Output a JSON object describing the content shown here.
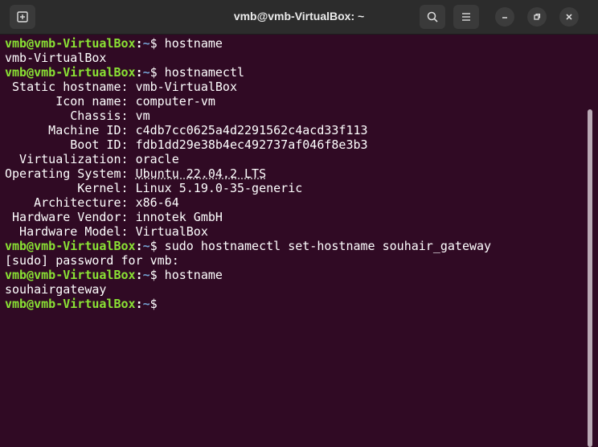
{
  "window": {
    "title": "vmb@vmb-VirtualBox: ~"
  },
  "prompt": {
    "user_host": "vmb@vmb-VirtualBox",
    "colon": ":",
    "path": "~",
    "symbol": "$"
  },
  "terminal": {
    "lines": [
      {
        "type": "prompt",
        "cmd": " hostname"
      },
      {
        "type": "output",
        "text": "vmb-VirtualBox"
      },
      {
        "type": "prompt",
        "cmd": " hostnamectl"
      },
      {
        "type": "kv",
        "key": " Static hostname: ",
        "value": "vmb-VirtualBox"
      },
      {
        "type": "kv",
        "key": "       Icon name: ",
        "value": "computer-vm"
      },
      {
        "type": "kv",
        "key": "         Chassis: ",
        "value": "vm"
      },
      {
        "type": "kv",
        "key": "      Machine ID: ",
        "value": "c4db7cc0625a4d2291562c4acd33f113"
      },
      {
        "type": "kv",
        "key": "         Boot ID: ",
        "value": "fdb1dd29e38b4ec492737af046f8e3b3"
      },
      {
        "type": "kv",
        "key": "  Virtualization: ",
        "value": "oracle"
      },
      {
        "type": "kv_os",
        "key": "Operating System: ",
        "value": "Ubuntu 22.04.2 LTS"
      },
      {
        "type": "kv",
        "key": "          Kernel: ",
        "value": "Linux 5.19.0-35-generic"
      },
      {
        "type": "kv",
        "key": "    Architecture: ",
        "value": "x86-64"
      },
      {
        "type": "kv",
        "key": " Hardware Vendor: ",
        "value": "innotek GmbH"
      },
      {
        "type": "kv",
        "key": "  Hardware Model: ",
        "value": "VirtualBox"
      },
      {
        "type": "prompt",
        "cmd": " sudo hostnamectl set-hostname souhair_gateway"
      },
      {
        "type": "output",
        "text": "[sudo] password for vmb:"
      },
      {
        "type": "prompt",
        "cmd": " hostname"
      },
      {
        "type": "output",
        "text": "souhairgateway"
      },
      {
        "type": "prompt",
        "cmd": " "
      }
    ]
  },
  "icons": {
    "new_tab": "new-tab-icon",
    "search": "search-icon",
    "menu": "hamburger-menu-icon",
    "minimize": "minimize-icon",
    "maximize": "restore-icon",
    "close": "close-icon"
  },
  "colors": {
    "background": "#300a24",
    "titlebar": "#2c2c2c",
    "prompt_user": "#8ae234",
    "prompt_path": "#729fcf"
  }
}
